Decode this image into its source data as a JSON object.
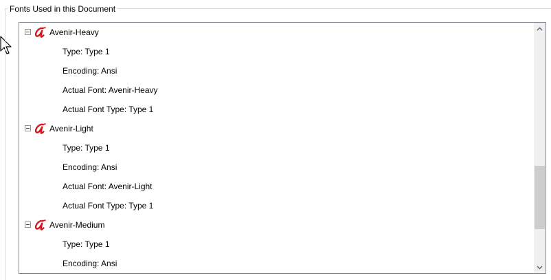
{
  "group": {
    "title": "Fonts Used in this Document"
  },
  "fonts": [
    {
      "name": "Avenir-Heavy",
      "icon": "acrobat-font-icon",
      "properties": [
        "Type: Type 1",
        "Encoding: Ansi",
        "Actual Font: Avenir-Heavy",
        "Actual Font Type: Type 1"
      ]
    },
    {
      "name": "Avenir-Light",
      "icon": "acrobat-font-icon",
      "properties": [
        "Type: Type 1",
        "Encoding: Ansi",
        "Actual Font: Avenir-Light",
        "Actual Font Type: Type 1"
      ]
    },
    {
      "name": "Avenir-Medium",
      "icon": "acrobat-font-icon",
      "properties": [
        "Type: Type 1",
        "Encoding: Ansi"
      ]
    }
  ],
  "scrollbar": {
    "up_icon": "chevron-up-icon",
    "down_icon": "chevron-down-icon"
  },
  "colors": {
    "font_icon": "#d4171e",
    "scroll_thumb": "#cdcdcd",
    "scroll_track": "#f0f0f0",
    "list_border": "#828790"
  }
}
